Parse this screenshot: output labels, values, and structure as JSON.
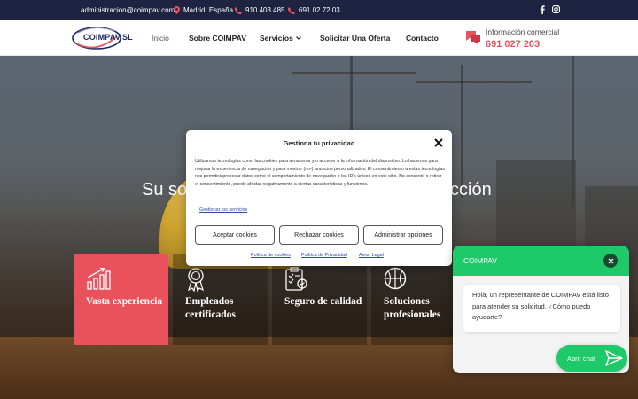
{
  "topbar": {
    "email": "administracion@coimpav.com",
    "location": "Madrid, España",
    "phone1": "910.403.485",
    "phone2": "691.02.72.03",
    "icons": [
      "mail",
      "map-pin-icon",
      "phone-icon",
      "phone-icon",
      "facebook-icon",
      "instagram-icon"
    ]
  },
  "header": {
    "logo_text": "COIMPAV.SL",
    "nav": [
      "Inicio",
      "Sobre COIMPAV",
      "Servicios",
      "Solicitar Una Oferta",
      "Contacto"
    ],
    "info_label": "Información comercial",
    "info_phone": "691 027 203"
  },
  "hero": {
    "title_left": "Su so",
    "title_right": "cción",
    "features": [
      {
        "label": "Vasta experiencia",
        "icon": "growth-chart-icon"
      },
      {
        "label": "Empleados certificados",
        "icon": "award-badge-icon"
      },
      {
        "label": "Seguro de calidad",
        "icon": "clipboard-check-icon"
      },
      {
        "label": "Soluciones profesionales",
        "icon": "basketball-icon"
      }
    ]
  },
  "cookie_modal": {
    "title": "Gestiona tu privacidad",
    "body": "Utilizamos tecnologías como las cookies para almacenar y/o acceder a la información del dispositivo. Lo hacemos para mejorar la experiencia de navegación y para mostrar (no-) anuncios personalizados. El consentimiento a estas tecnologías nos permitirá procesar datos como el comportamiento de navegación o los ID's únicos en este sitio. No consentir o retirar el consentimiento, puede afectar negativamente a ciertas características y funciones.",
    "manage_link": "Gestionar los servicios",
    "accept": "Aceptar cookies",
    "reject": "Rechazar cookies",
    "manage_options": "Administrar opciones",
    "links": [
      "Política de cookies",
      "Política de Privacidad",
      "Aviso Legal"
    ]
  },
  "chat": {
    "title": "COIMPAV",
    "message": "Hola, un representante de COIMPAV está listo para atender su solicitud. ¿Cómo puedo ayudarte?",
    "open_label": "Abrir chat"
  },
  "colors": {
    "topbar_bg": "#1d2340",
    "accent_red": "#e9525c",
    "chat_green": "#1ec96a",
    "link_blue": "#2f4aa8"
  }
}
